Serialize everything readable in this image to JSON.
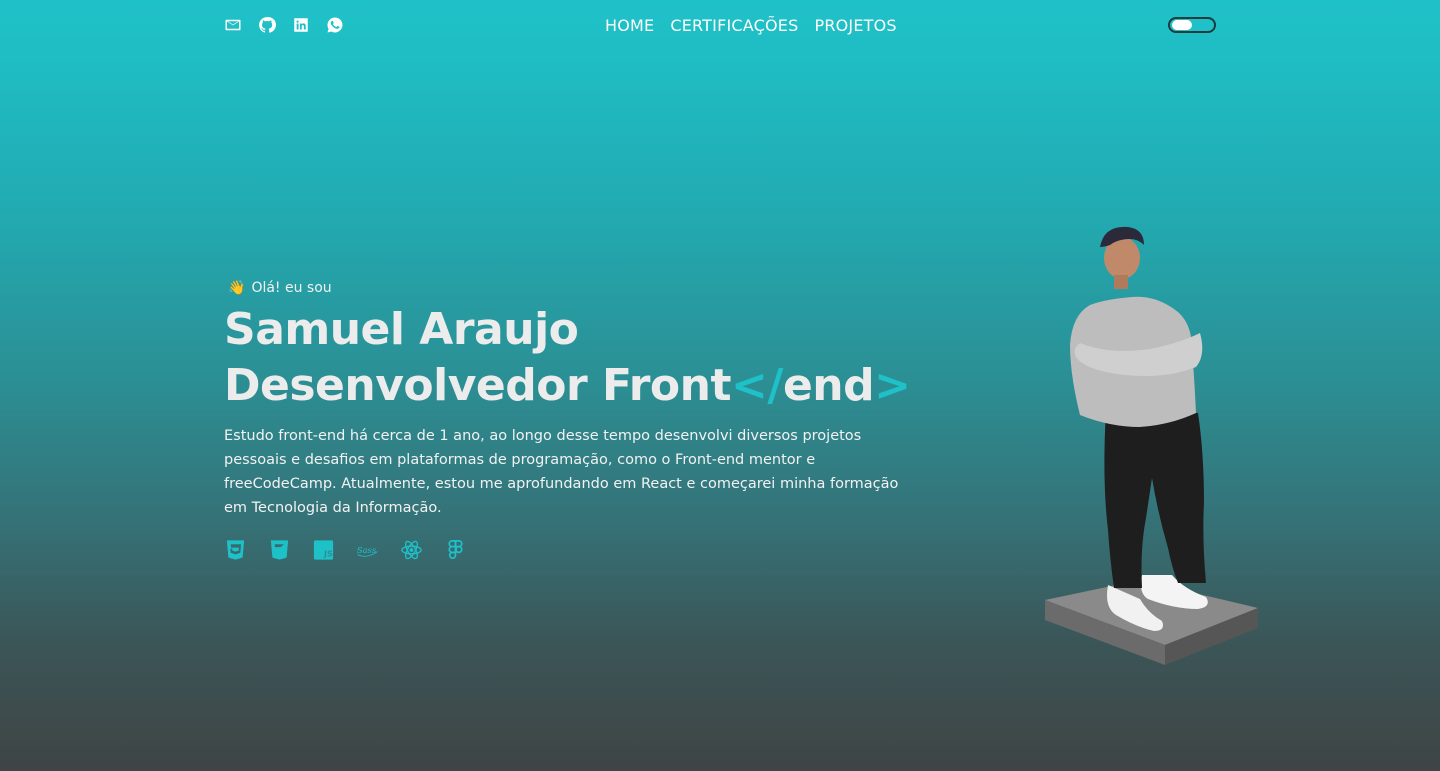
{
  "header": {
    "socials": [
      {
        "icon": "mail-icon"
      },
      {
        "icon": "github-icon"
      },
      {
        "icon": "linkedin-icon"
      },
      {
        "icon": "whatsapp-icon"
      }
    ],
    "nav": [
      "HOME",
      "CERTIFICAÇÕES",
      "PROJETOS"
    ],
    "theme_toggle": {
      "state": "light"
    }
  },
  "hero": {
    "greeting_emoji": "👋",
    "greeting": "Olá! eu sou",
    "name": "Samuel Araujo",
    "role_prefix": "Desenvolvedor Front",
    "role_code": "</",
    "role_suffix": "end",
    "role_close": ">",
    "description": "Estudo front-end há cerca de 1 ano, ao longo desse tempo desenvolvi diversos projetos pessoais e desafios em plataformas de programação, como o Front-end mentor e freeCodeCamp. Atualmente, estou me aprofundando em React e começarei minha formação em Tecnologia da Informação.",
    "techs": [
      {
        "icon": "html5-icon"
      },
      {
        "icon": "css3-icon"
      },
      {
        "icon": "javascript-icon"
      },
      {
        "icon": "sass-icon"
      },
      {
        "icon": "react-icon"
      },
      {
        "icon": "figma-icon"
      }
    ]
  },
  "colors": {
    "accent": "#1fc1c8",
    "text": "#ececec"
  }
}
